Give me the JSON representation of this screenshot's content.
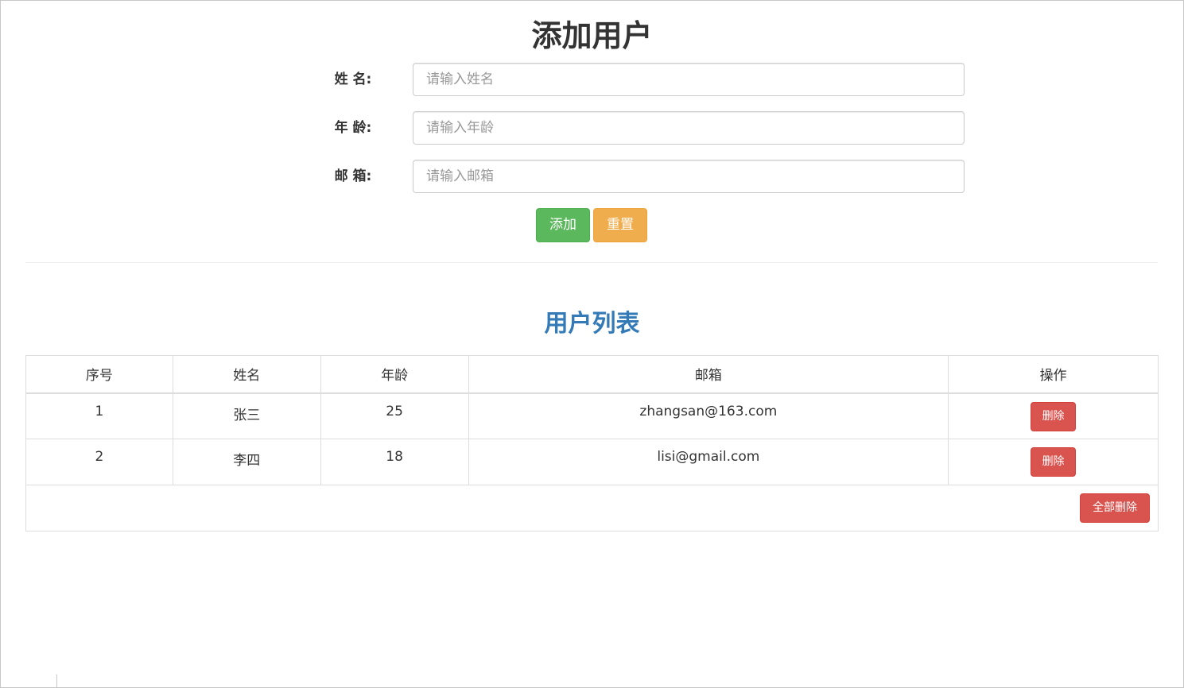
{
  "form": {
    "title": "添加用户",
    "name_label": "姓 名:",
    "name_placeholder": "请输入姓名",
    "age_label": "年 龄:",
    "age_placeholder": "请输入年龄",
    "email_label": "邮 箱:",
    "email_placeholder": "请输入邮箱",
    "add_label": "添加",
    "reset_label": "重置"
  },
  "list": {
    "title": "用户列表",
    "headers": [
      "序号",
      "姓名",
      "年龄",
      "邮箱",
      "操作"
    ],
    "rows": [
      {
        "index": "1",
        "name": "张三",
        "age": "25",
        "email": "zhangsan@163.com",
        "action": "删除"
      },
      {
        "index": "2",
        "name": "李四",
        "age": "18",
        "email": "lisi@gmail.com",
        "action": "删除"
      }
    ],
    "delete_all_label": "全部删除"
  },
  "colors": {
    "add": "#5cb85c",
    "reset": "#f0ad4e",
    "danger": "#d9534f",
    "list_title": "#337ab7"
  }
}
